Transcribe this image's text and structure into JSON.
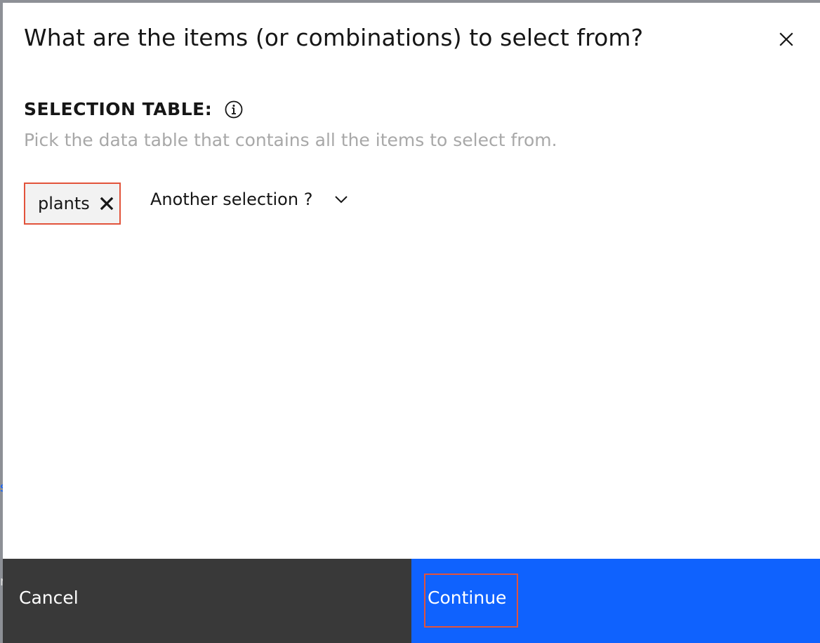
{
  "dialog": {
    "title": "What are the items (or combinations) to select from?",
    "close_icon": "close-icon"
  },
  "selection_table": {
    "label": "SELECTION TABLE:",
    "info_icon": "info-icon",
    "helper": "Pick the data table that contains all the items to select from.",
    "selected_tag": {
      "label": "plants",
      "remove_icon": "close-icon"
    },
    "dropdown": {
      "label": "Another selection ?",
      "icon": "chevron-down-icon"
    }
  },
  "footer": {
    "cancel_label": "Cancel",
    "continue_label": "Continue"
  },
  "colors": {
    "primary": "#0f62fe",
    "secondary": "#393939",
    "highlight": "#e2533b",
    "text": "#161616",
    "helper_text": "#a8a8a8"
  }
}
